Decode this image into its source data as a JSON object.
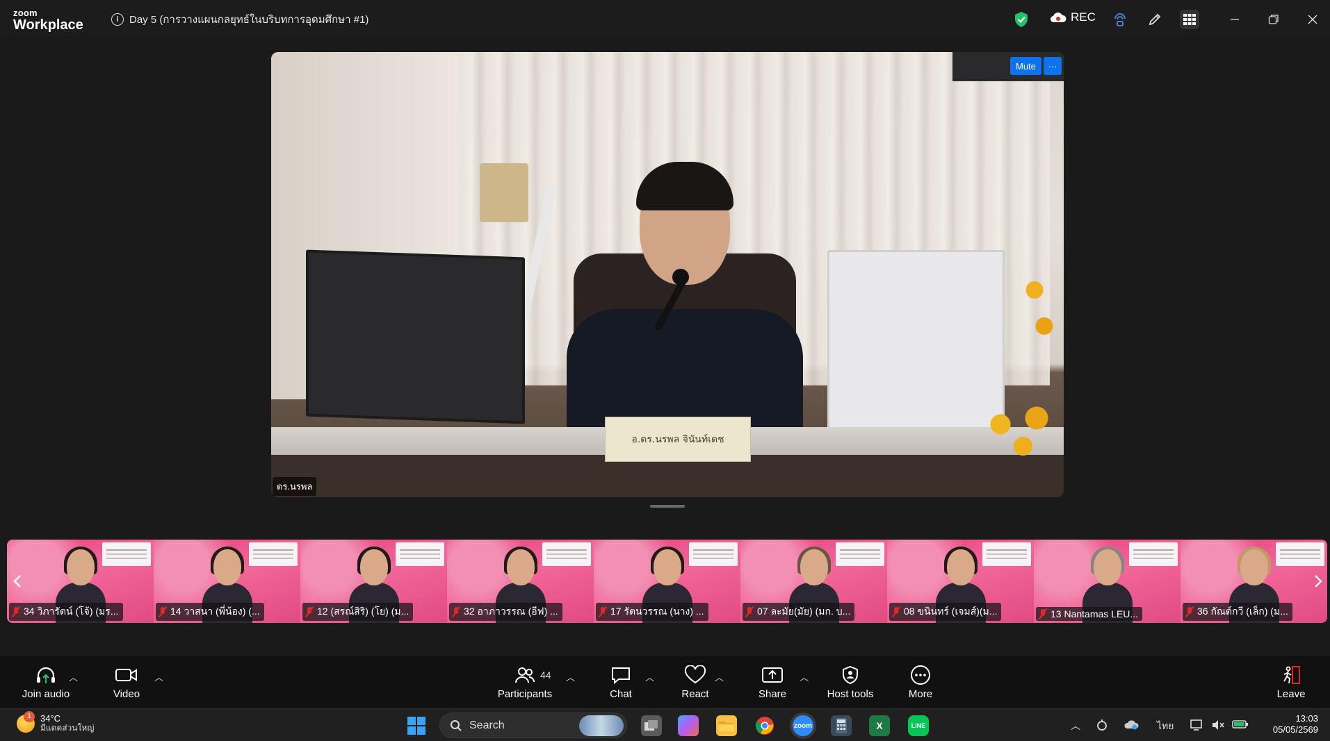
{
  "titlebar": {
    "logo_line1": "zoom",
    "logo_line2": "Workplace",
    "meeting_title": "Day 5 (การวางแผนกลยุทธ์ในบริบทการอุดมศึกษา #1)",
    "rec_label": "REC"
  },
  "main_video": {
    "speaker_name": "ดร.นรพล",
    "nameplate": "อ.ดร.นรพล จินันท์เดช",
    "mute_label": "Mute",
    "more_label": "···"
  },
  "gallery": [
    {
      "label": "34 วิภารัตน์ (โจ้) (มร..."
    },
    {
      "label": "14 วาสนา (พี่น้อง) (..."
    },
    {
      "label": "12 (สรณ์สิริ) (โย) (ม..."
    },
    {
      "label": "32 อาภาวรรณ (อีฟ) ..."
    },
    {
      "label": "17 รัตนวรรณ (นาง) ..."
    },
    {
      "label": "07 ละมัย(มัย) (มก. บ..."
    },
    {
      "label": "08 ขนินทร์ (เจมส์)(ม..."
    },
    {
      "label": "13 Nantamas LEU..."
    },
    {
      "label": "36 กัณต์กวี (เล็ก) (ม..."
    }
  ],
  "toolbar": {
    "join_audio": "Join audio",
    "video": "Video",
    "participants": "Participants",
    "participants_count": "44",
    "chat": "Chat",
    "react": "React",
    "share": "Share",
    "host_tools": "Host tools",
    "more": "More",
    "leave": "Leave"
  },
  "taskbar": {
    "weather_badge": "1",
    "temperature": "34°C",
    "weather_condition": "มีแดดส่วนใหญ่",
    "search_label": "Search",
    "language": "ไทย",
    "time": "13:03",
    "date": "05/05/2569"
  },
  "colors": {
    "accent_blue": "#0e72ed",
    "shield_green": "#23c16b",
    "muted_red": "#e02828",
    "gallery_pink": "#e23a79"
  }
}
